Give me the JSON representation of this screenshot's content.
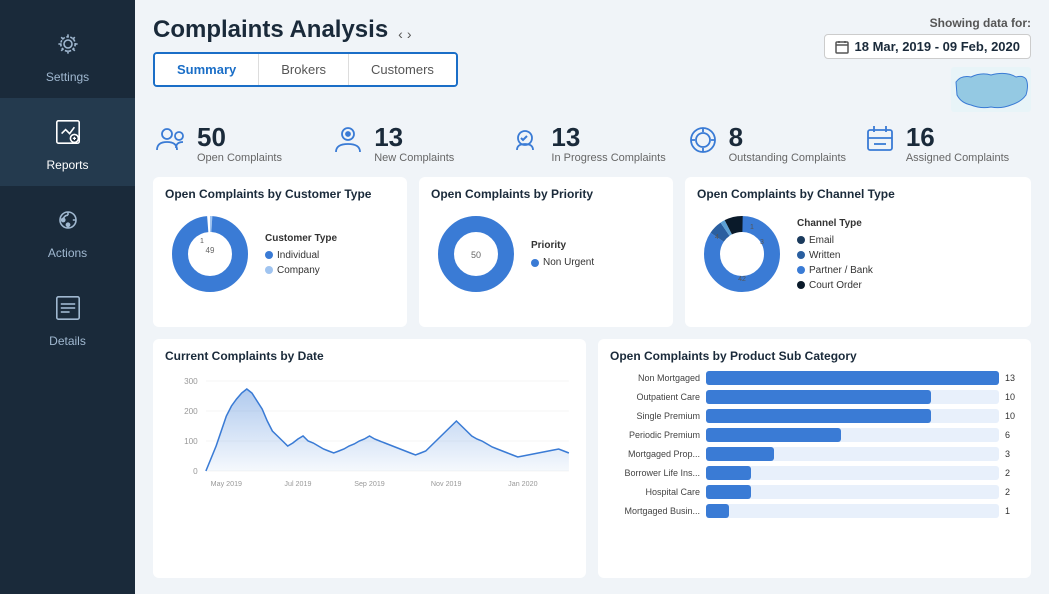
{
  "sidebar": {
    "items": [
      {
        "label": "Settings",
        "icon": "settings-icon",
        "active": false
      },
      {
        "label": "Reports",
        "icon": "reports-icon",
        "active": true
      },
      {
        "label": "Actions",
        "icon": "actions-icon",
        "active": false
      },
      {
        "label": "Details",
        "icon": "details-icon",
        "active": false
      }
    ]
  },
  "header": {
    "title": "Complaints Analysis",
    "tabs": [
      {
        "label": "Summary",
        "active": true
      },
      {
        "label": "Brokers",
        "active": false
      },
      {
        "label": "Customers",
        "active": false
      }
    ],
    "showing_data_label": "Showing data for:",
    "date_range": "18 Mar, 2019 - 09 Feb, 2020"
  },
  "stats": [
    {
      "number": "50",
      "label": "Open Complaints"
    },
    {
      "number": "13",
      "label": "New Complaints"
    },
    {
      "number": "13",
      "label": "In Progress Complaints"
    },
    {
      "number": "8",
      "label": "Outstanding Complaints"
    },
    {
      "number": "16",
      "label": "Assigned Complaints"
    }
  ],
  "charts": {
    "customer_type": {
      "title": "Open Complaints by Customer Type",
      "donut": {
        "individual": 49,
        "company": 1,
        "individual_color": "#3a7bd5",
        "company_color": "#a0c4f0"
      },
      "legend_title": "Customer Type",
      "legend": [
        {
          "label": "Individual",
          "color": "#3a7bd5"
        },
        {
          "label": "Company",
          "color": "#a0c4f0"
        }
      ]
    },
    "priority": {
      "title": "Open Complaints by Priority",
      "donut": {
        "non_urgent": 50,
        "non_urgent_color": "#3a7bd5"
      },
      "legend_title": "Priority",
      "legend": [
        {
          "label": "Non Urgent",
          "color": "#3a7bd5"
        }
      ]
    },
    "channel_type": {
      "title": "Open Complaints by Channel Type",
      "legend_title": "Channel Type",
      "legend": [
        {
          "label": "Email",
          "color": "#1a3a5c"
        },
        {
          "label": "Written",
          "color": "#2a5fa0"
        },
        {
          "label": "Partner / Bank",
          "color": "#3a7bd5"
        },
        {
          "label": "Court Order",
          "color": "#0a1a2a"
        }
      ],
      "segments": [
        42,
        3,
        1,
        4
      ]
    }
  },
  "line_chart": {
    "title": "Current Complaints by Date",
    "y_labels": [
      "300",
      "200",
      "100",
      "0"
    ],
    "x_labels": [
      "May 2019",
      "Jul 2019",
      "Sep 2019",
      "Nov 2019",
      "Jan 2020"
    ]
  },
  "bar_chart": {
    "title": "Open Complaints by Product Sub Category",
    "bars": [
      {
        "label": "Non Mortgaged",
        "value": 13,
        "max": 13
      },
      {
        "label": "Outpatient Care",
        "value": 10,
        "max": 13
      },
      {
        "label": "Single Premium",
        "value": 10,
        "max": 13
      },
      {
        "label": "Periodic Premium",
        "value": 6,
        "max": 13
      },
      {
        "label": "Mortgaged Prop...",
        "value": 3,
        "max": 13
      },
      {
        "label": "Borrower Life Ins...",
        "value": 2,
        "max": 13
      },
      {
        "label": "Hospital Care",
        "value": 2,
        "max": 13
      },
      {
        "label": "Mortgaged Busin...",
        "value": 1,
        "max": 13
      }
    ]
  },
  "colors": {
    "sidebar_bg": "#1a2a3a",
    "accent": "#3a7bd5",
    "text_dark": "#1a2a3a"
  }
}
